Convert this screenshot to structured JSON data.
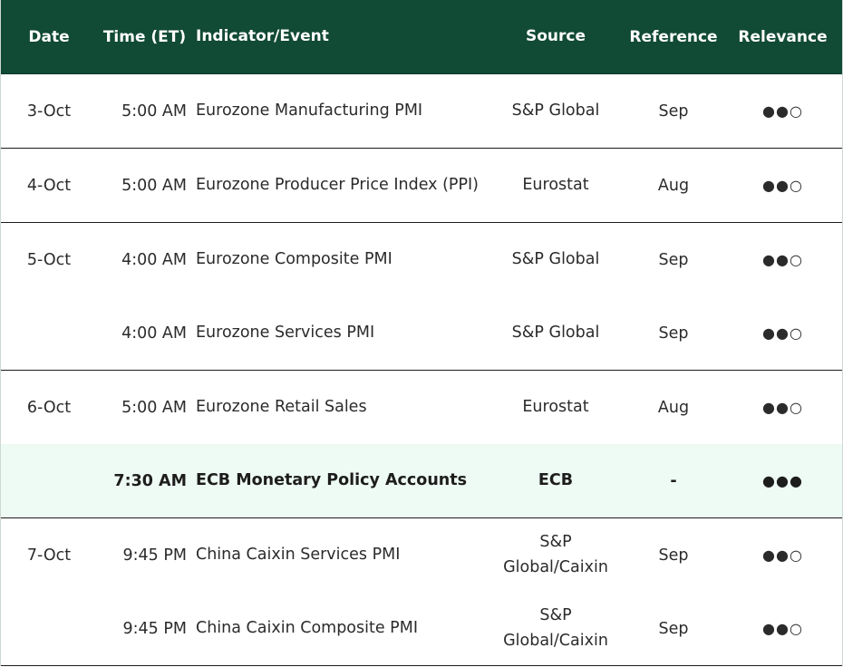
{
  "header": {
    "date": "Date",
    "time": "Time (ET)",
    "indicator": "Indicator/Event",
    "source": "Source",
    "reference": "Reference",
    "relevance": "Relevance"
  },
  "colors": {
    "header_bg": "#114a35",
    "highlight_bg": "#eefaf4"
  },
  "rows": [
    {
      "date": "3-Oct",
      "time": "5:00 AM",
      "indicator": "Eurozone Manufacturing PMI",
      "source": "S&P Global",
      "reference": "Sep",
      "relevance": "●●○"
    },
    {
      "date": "4-Oct",
      "time": "5:00 AM",
      "indicator": "Eurozone Producer Price Index (PPI)",
      "source": "Eurostat",
      "reference": "Aug",
      "relevance": "●●○"
    },
    {
      "date": "5-Oct",
      "time": "4:00 AM",
      "indicator": "Eurozone Composite PMI",
      "source": "S&P Global",
      "reference": "Sep",
      "relevance": "●●○"
    },
    {
      "date": "",
      "time": "4:00 AM",
      "indicator": "Eurozone Services PMI",
      "source": "S&P Global",
      "reference": "Sep",
      "relevance": "●●○"
    },
    {
      "date": "6-Oct",
      "time": "5:00 AM",
      "indicator": "Eurozone Retail Sales",
      "source": "Eurostat",
      "reference": "Aug",
      "relevance": "●●○"
    },
    {
      "date": "",
      "time": "7:30 AM",
      "indicator": "ECB Monetary Policy Accounts",
      "source": "ECB",
      "reference": "-",
      "relevance": "●●●"
    },
    {
      "date": "7-Oct",
      "time": "9:45 PM",
      "indicator": "China Caixin Services PMI",
      "source": "S&P Global/Caixin",
      "reference": "Sep",
      "relevance": "●●○"
    },
    {
      "date": "",
      "time": "9:45 PM",
      "indicator": "China Caixin Composite PMI",
      "source": "S&P Global/Caixin",
      "reference": "Sep",
      "relevance": "●●○"
    }
  ]
}
